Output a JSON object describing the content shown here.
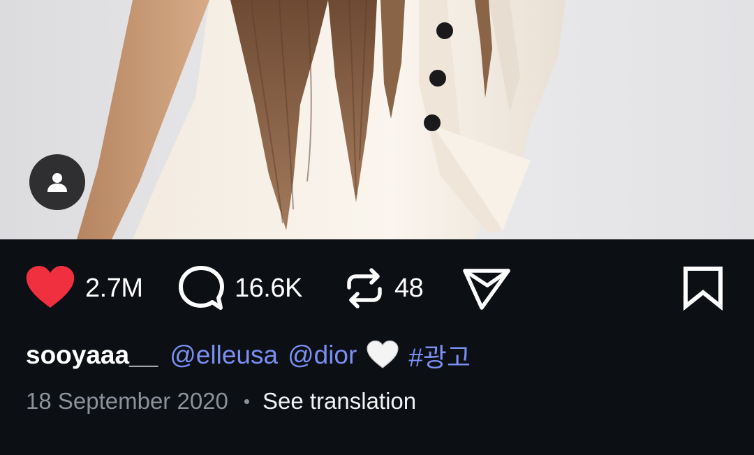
{
  "post": {
    "username": "sooyaaa__",
    "mentions": [
      "@elleusa",
      "@dior"
    ],
    "emoji": "white-heart",
    "hashtag": "#광고",
    "date": "18 September 2020",
    "separator": "•",
    "translate_label": "See translation"
  },
  "actions": {
    "likes": "2.7M",
    "comments": "16.6K",
    "reposts": "48",
    "liked": true
  },
  "colors": {
    "background": "#0c0f14",
    "like": "#f0303f",
    "link": "#7b8ff2",
    "muted": "#8c929b"
  },
  "icons": [
    "user-icon",
    "heart-icon",
    "comment-icon",
    "repost-icon",
    "share-icon",
    "bookmark-icon"
  ]
}
